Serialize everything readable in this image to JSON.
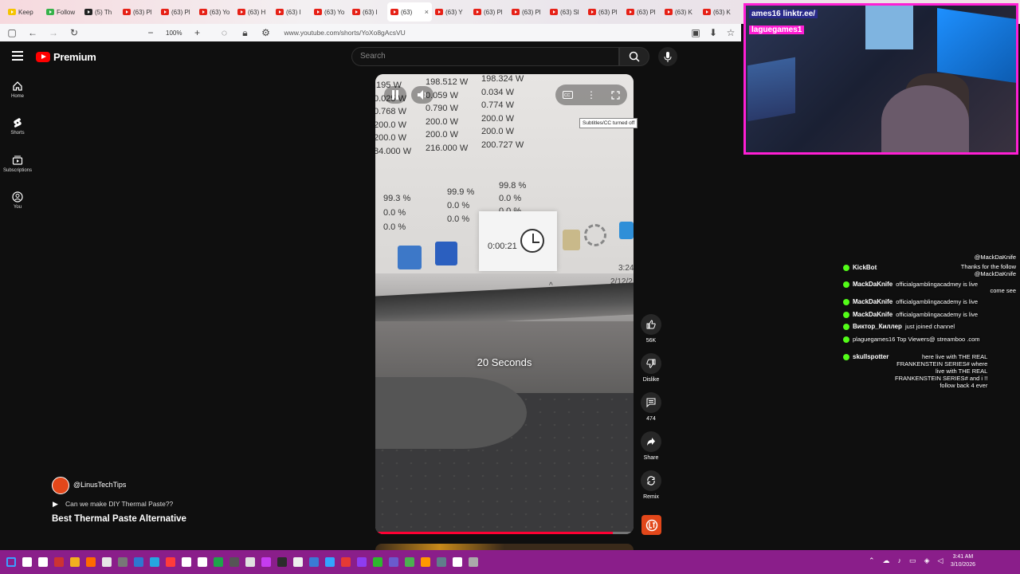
{
  "browser": {
    "tabs": [
      {
        "label": "Keep",
        "kind": "yellow"
      },
      {
        "label": "Follow",
        "kind": "green"
      },
      {
        "label": "(5) Th",
        "kind": "x"
      },
      {
        "label": "(63) Pl",
        "kind": "yt"
      },
      {
        "label": "(63) Pl",
        "kind": "yt"
      },
      {
        "label": "(63) Yo",
        "kind": "yt"
      },
      {
        "label": "(63) H",
        "kind": "yt"
      },
      {
        "label": "(63) I",
        "kind": "yt"
      },
      {
        "label": "(63) Yo",
        "kind": "yt"
      },
      {
        "label": "(63) I",
        "kind": "yt"
      },
      {
        "label": "(63)",
        "kind": "yt",
        "active": true
      },
      {
        "label": "(63) Y",
        "kind": "yt"
      },
      {
        "label": "(63) Pl",
        "kind": "yt"
      },
      {
        "label": "(63) Pl",
        "kind": "yt"
      },
      {
        "label": "(63) Sl",
        "kind": "yt"
      },
      {
        "label": "(63) Pl",
        "kind": "yt"
      },
      {
        "label": "(63) Pl",
        "kind": "yt"
      },
      {
        "label": "(63) K",
        "kind": "yt"
      },
      {
        "label": "(63) K",
        "kind": "yt"
      }
    ],
    "zoom": "100%",
    "url": "www.youtube.com/shorts/YoXo8gAcsVU"
  },
  "youtube": {
    "logo_text": "Premium",
    "search_placeholder": "Search",
    "sidebar": [
      {
        "label": "Home",
        "icon": "home-icon"
      },
      {
        "label": "Shorts",
        "icon": "shorts-icon"
      },
      {
        "label": "Subscriptions",
        "icon": "subscriptions-icon"
      },
      {
        "label": "You",
        "icon": "you-icon"
      }
    ]
  },
  "video": {
    "readings": {
      "col1": [
        ".195 W",
        "0.025 W",
        "0.768 W",
        "200.0 W",
        "200.0 W",
        "84.000 W"
      ],
      "col2": [
        "198.512 W",
        "0.059 W",
        "0.790 W",
        "200.0 W",
        "200.0 W",
        "216.000 W"
      ],
      "col3": [
        "198.324 W",
        "0.034 W",
        "0.774 W",
        "200.0 W",
        "200.0 W",
        "200.727 W"
      ],
      "pct1": [
        "99.3 %",
        "0.0 %",
        "0.0 %"
      ],
      "pct2": [
        "99.9 %",
        "0.0 %",
        "0.0 %"
      ],
      "pct3": [
        "99.8 %",
        "0.0 %",
        "0.0 %"
      ]
    },
    "timer": "0:00:21",
    "screen_clock": "3:24",
    "screen_date": "2/12/2",
    "caption": "20 Seconds",
    "tooltip": "Subtitles/CC turned off",
    "progress": 0.92
  },
  "actions": {
    "likes": "56K",
    "dislike": "Dislike",
    "comments": "474",
    "share": "Share",
    "remix": "Remix"
  },
  "meta": {
    "channel": "@LinusTechTips",
    "related": "Can we make DIY Thermal Paste??",
    "title": "Best Thermal Paste Alternative"
  },
  "webcam": {
    "tag1": "ames16 linktr.ee/",
    "tag2": "laguegames1"
  },
  "chat": {
    "rows": [
      {
        "name": "KickBot",
        "msg": ""
      },
      {
        "name": "MackDaKnife",
        "msg": "officialgamblingacadmey is live"
      },
      {
        "name": "MackDaKnife",
        "msg": "officialgamblingacademy is live"
      },
      {
        "name": "MackDaKnife",
        "msg": "officialgamblingacademy is live"
      },
      {
        "name": "Виктор_Киллер",
        "msg": "just joined channel"
      },
      {
        "name": "",
        "msg": "plaguegames16 Top Viewers@ streamboo .com"
      },
      {
        "name": "skullspotter",
        "msg": "here live with THE REAL FRANKENSTEIN SERIES# where live with THE REAL FRANKENSTEIN SERIES# and i !! follow back 4 ever"
      }
    ],
    "right_lines": [
      "@MackDaKnife",
      "Thanks for the follow",
      "@MackDaKnife",
      "come see"
    ]
  },
  "taskbar": {
    "time": "3:41 AM",
    "date": "3/10/2026"
  }
}
